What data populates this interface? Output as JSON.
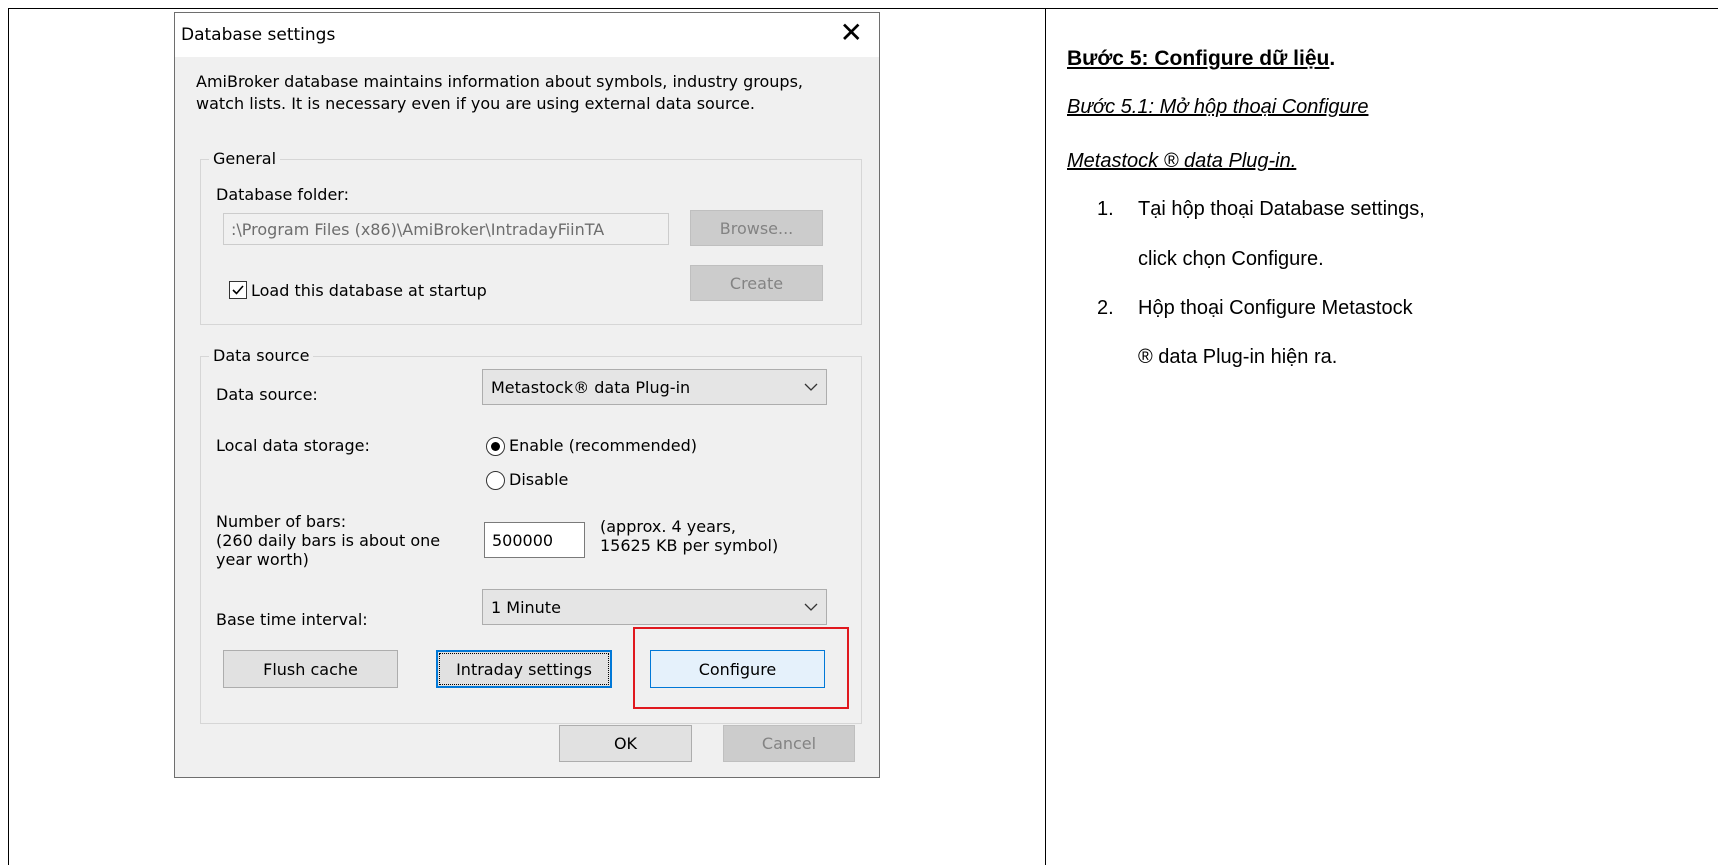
{
  "dialog": {
    "title": "Database settings",
    "intro_line1": "AmiBroker database maintains information about symbols, industry groups,",
    "intro_line2": "watch lists. It is necessary even if you are using external data source.",
    "general": {
      "legend": "General",
      "folder_label": "Database folder:",
      "folder_value": ":\\Program Files (x86)\\AmiBroker\\IntradayFiinTA",
      "browse_label": "Browse...",
      "create_label": "Create",
      "load_checkbox_label": "Load this database at startup",
      "load_checked": true
    },
    "data_source": {
      "legend": "Data source",
      "source_label": "Data source:",
      "source_value": "Metastock® data Plug-in",
      "storage_label": "Local data storage:",
      "enable_label": "Enable (recommended)",
      "disable_label": "Disable",
      "storage_selected": "enable",
      "bars_label_1": "Number of bars:",
      "bars_label_2": "(260 daily bars is about one",
      "bars_label_3": "year worth)",
      "bars_value": "500000",
      "bars_note_1": "(approx. 4 years,",
      "bars_note_2": "15625 KB per symbol)",
      "interval_label": "Base time interval:",
      "interval_value": "1 Minute",
      "flush_label": "Flush cache",
      "intraday_label": "Intraday settings",
      "configure_label": "Configure"
    },
    "ok_label": "OK",
    "cancel_label": "Cancel",
    "highlight_color": "#e0181e"
  },
  "instructions": {
    "step_title": "Bước 5: Configure dữ liệu",
    "step_title_suffix": ".",
    "substep_line1": "Bước 5.1: Mở hộp thoại Configure",
    "substep_line2": "Metastock ® data Plug-in.",
    "items": [
      {
        "num": "1.",
        "line1": "Tại hộp thoại Database settings,",
        "line2": "click chọn Configure."
      },
      {
        "num": "2.",
        "line1": "Hộp thoại Configure Metastock",
        "line2": "® data Plug-in hiện ra."
      }
    ]
  }
}
